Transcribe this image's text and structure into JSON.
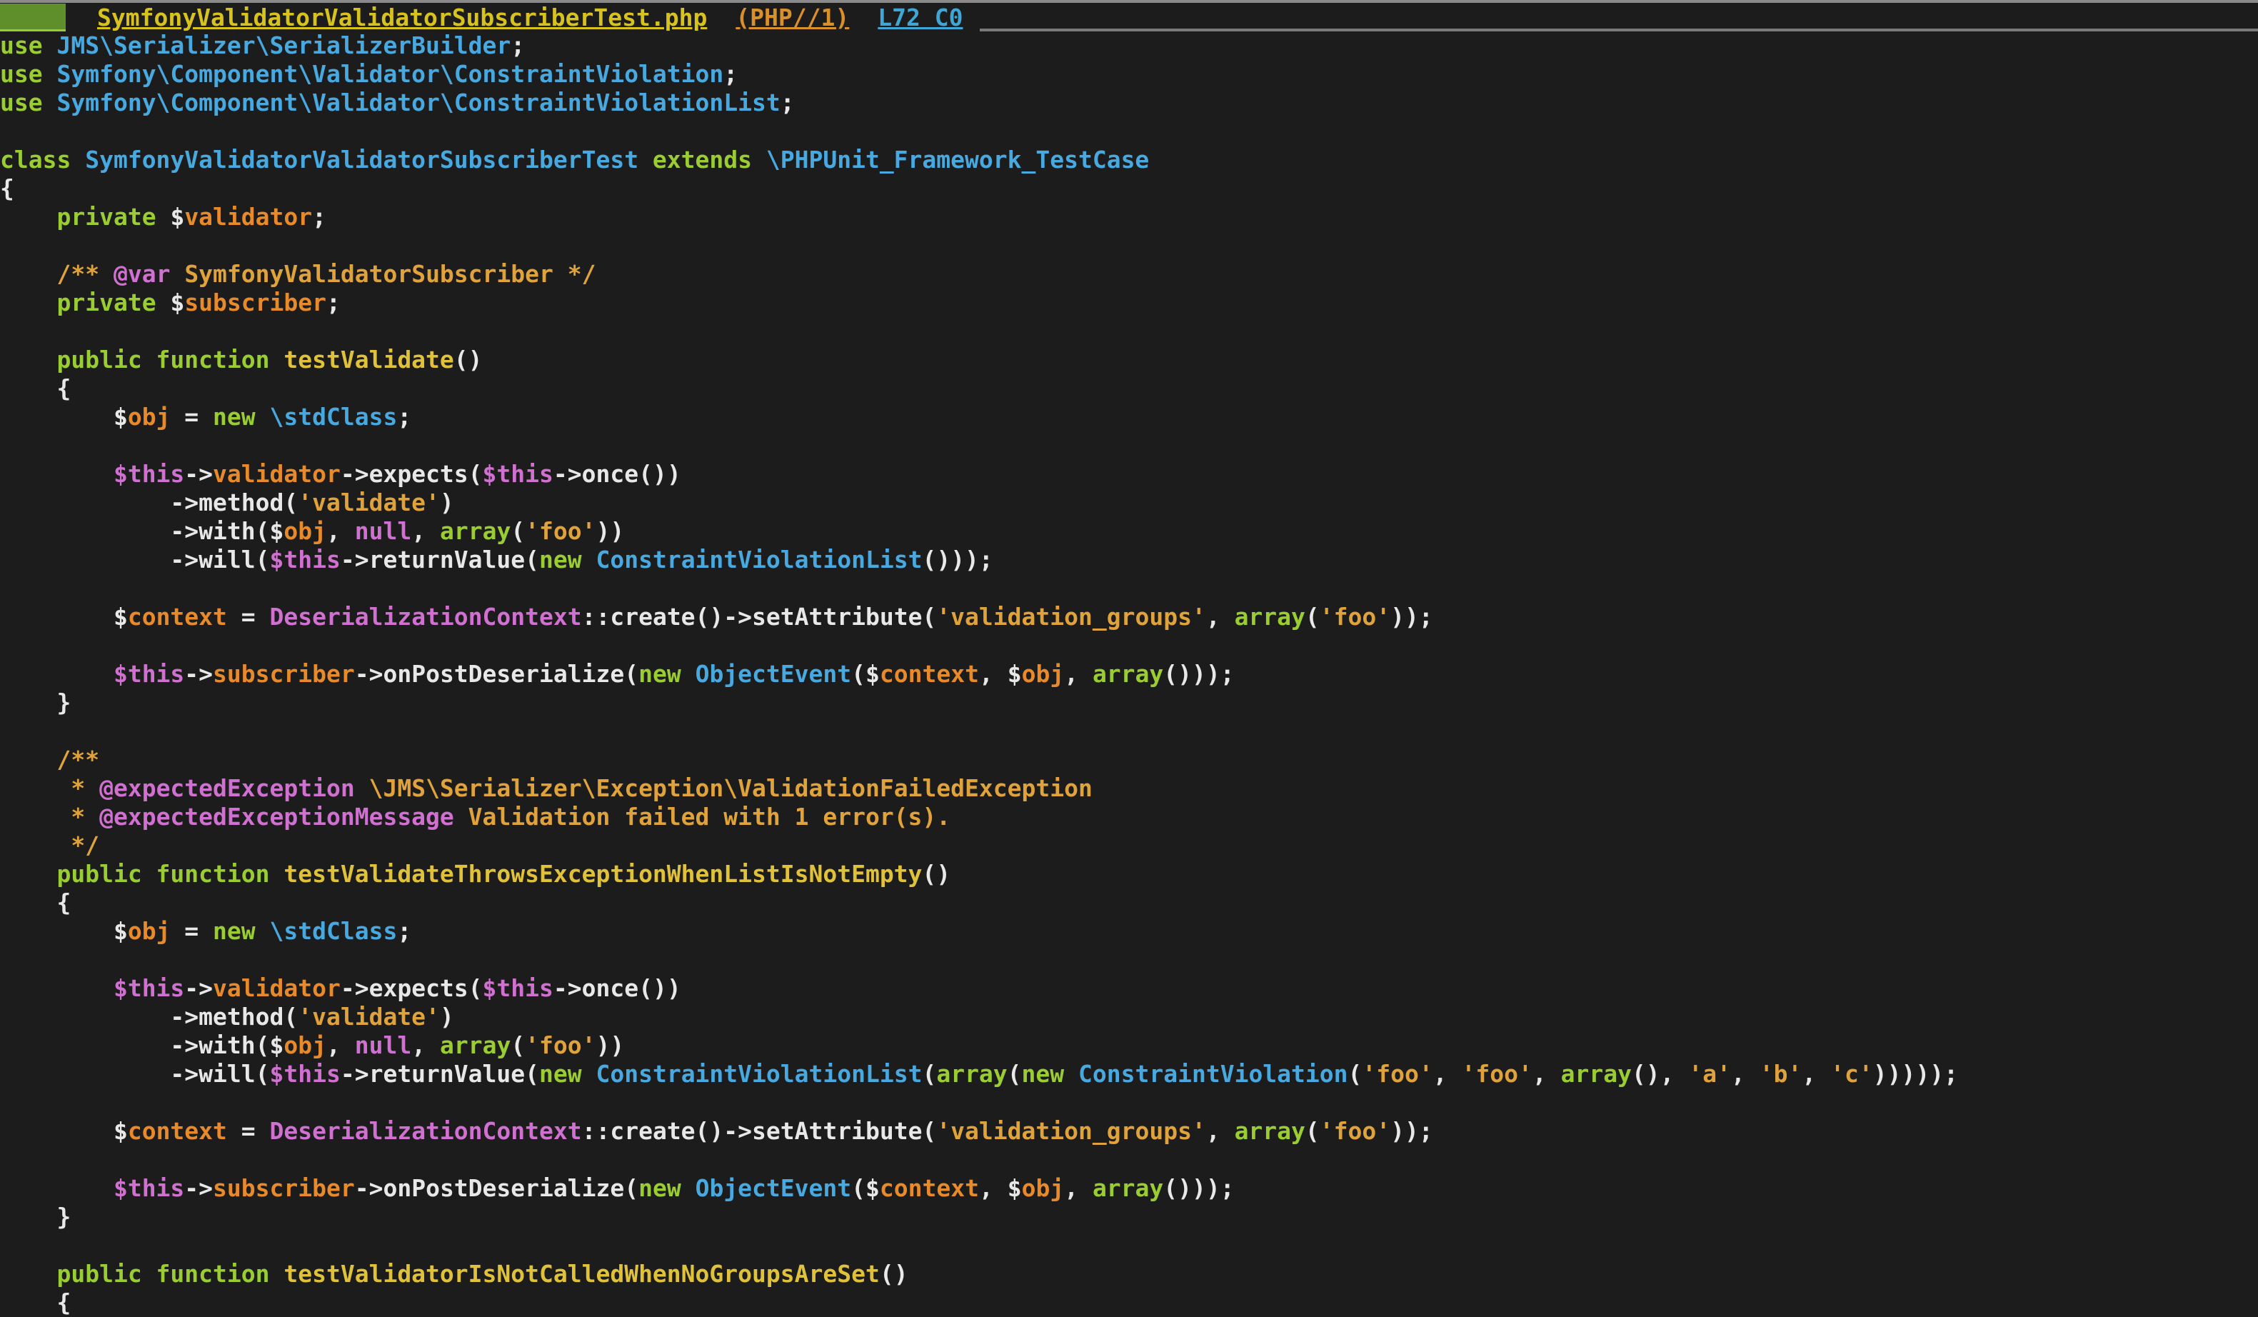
{
  "tabline": {
    "filename": "SymfonyValidatorValidatorSubscriberTest.php",
    "filetype": "(PHP//1)",
    "position": "L72 C0"
  },
  "code_lines": [
    [
      [
        "kw",
        "use "
      ],
      [
        "cls",
        "JMS\\Serializer\\SerializerBuilder"
      ],
      [
        "plain",
        ";"
      ]
    ],
    [
      [
        "kw",
        "use "
      ],
      [
        "cls",
        "Symfony\\Component\\Validator\\ConstraintViolation"
      ],
      [
        "plain",
        ";"
      ]
    ],
    [
      [
        "kw",
        "use "
      ],
      [
        "cls",
        "Symfony\\Component\\Validator\\ConstraintViolationList"
      ],
      [
        "plain",
        ";"
      ]
    ],
    [],
    [
      [
        "kw",
        "class "
      ],
      [
        "cls",
        "SymfonyValidatorValidatorSubscriberTest"
      ],
      [
        "kw",
        " extends "
      ],
      [
        "cls",
        "\\PHPUnit_Framework_TestCase"
      ]
    ],
    [
      [
        "plain",
        "{"
      ]
    ],
    [
      [
        "plain",
        "    "
      ],
      [
        "kw",
        "private "
      ],
      [
        "dlr",
        "$"
      ],
      [
        "var",
        "validator"
      ],
      [
        "plain",
        ";"
      ]
    ],
    [],
    [
      [
        "plain",
        "    "
      ],
      [
        "cmt",
        "/** "
      ],
      [
        "ann",
        "@var "
      ],
      [
        "cmt",
        "SymfonyValidatorSubscriber */"
      ]
    ],
    [
      [
        "plain",
        "    "
      ],
      [
        "kw",
        "private "
      ],
      [
        "dlr",
        "$"
      ],
      [
        "var",
        "subscriber"
      ],
      [
        "plain",
        ";"
      ]
    ],
    [],
    [
      [
        "plain",
        "    "
      ],
      [
        "kw",
        "public function "
      ],
      [
        "fn",
        "testValidate"
      ],
      [
        "plain",
        "()"
      ]
    ],
    [
      [
        "plain",
        "    {"
      ]
    ],
    [
      [
        "plain",
        "        "
      ],
      [
        "dlr",
        "$"
      ],
      [
        "var",
        "obj"
      ],
      [
        "plain",
        " = "
      ],
      [
        "kw",
        "new "
      ],
      [
        "cls",
        "\\stdClass"
      ],
      [
        "plain",
        ";"
      ]
    ],
    [],
    [
      [
        "plain",
        "        "
      ],
      [
        "this",
        "$this"
      ],
      [
        "plain",
        "->"
      ],
      [
        "var",
        "validator"
      ],
      [
        "plain",
        "->expects("
      ],
      [
        "this",
        "$this"
      ],
      [
        "plain",
        "->once())"
      ]
    ],
    [
      [
        "plain",
        "            ->method("
      ],
      [
        "str",
        "'validate'"
      ],
      [
        "plain",
        ")"
      ]
    ],
    [
      [
        "plain",
        "            ->with("
      ],
      [
        "dlr",
        "$"
      ],
      [
        "var",
        "obj"
      ],
      [
        "plain",
        ", "
      ],
      [
        "this",
        "null"
      ],
      [
        "plain",
        ", "
      ],
      [
        "kw",
        "array"
      ],
      [
        "plain",
        "("
      ],
      [
        "str",
        "'foo'"
      ],
      [
        "plain",
        "))"
      ]
    ],
    [
      [
        "plain",
        "            ->will("
      ],
      [
        "this",
        "$this"
      ],
      [
        "plain",
        "->returnValue("
      ],
      [
        "kw",
        "new "
      ],
      [
        "cls",
        "ConstraintViolationList"
      ],
      [
        "plain",
        "()));"
      ]
    ],
    [],
    [
      [
        "plain",
        "        "
      ],
      [
        "dlr",
        "$"
      ],
      [
        "var",
        "context"
      ],
      [
        "plain",
        " = "
      ],
      [
        "this",
        "DeserializationContext"
      ],
      [
        "plain",
        "::create()->setAttribute("
      ],
      [
        "str",
        "'validation_groups'"
      ],
      [
        "plain",
        ", "
      ],
      [
        "kw",
        "array"
      ],
      [
        "plain",
        "("
      ],
      [
        "str",
        "'foo'"
      ],
      [
        "plain",
        "));"
      ]
    ],
    [],
    [
      [
        "plain",
        "        "
      ],
      [
        "this",
        "$this"
      ],
      [
        "plain",
        "->"
      ],
      [
        "var",
        "subscriber"
      ],
      [
        "plain",
        "->onPostDeserialize("
      ],
      [
        "kw",
        "new "
      ],
      [
        "cls",
        "ObjectEvent"
      ],
      [
        "plain",
        "("
      ],
      [
        "dlr",
        "$"
      ],
      [
        "var",
        "context"
      ],
      [
        "plain",
        ", "
      ],
      [
        "dlr",
        "$"
      ],
      [
        "var",
        "obj"
      ],
      [
        "plain",
        ", "
      ],
      [
        "kw",
        "array"
      ],
      [
        "plain",
        "()));"
      ]
    ],
    [
      [
        "plain",
        "    }"
      ]
    ],
    [],
    [
      [
        "plain",
        "    "
      ],
      [
        "cmt",
        "/**"
      ]
    ],
    [
      [
        "plain",
        "     "
      ],
      [
        "cmt",
        "* "
      ],
      [
        "ann",
        "@expectedException "
      ],
      [
        "cmt",
        "\\JMS\\Serializer\\Exception\\ValidationFailedException"
      ]
    ],
    [
      [
        "plain",
        "     "
      ],
      [
        "cmt",
        "* "
      ],
      [
        "ann",
        "@expectedExceptionMessage "
      ],
      [
        "cmt",
        "Validation failed with 1 error(s)."
      ]
    ],
    [
      [
        "plain",
        "     "
      ],
      [
        "cmt",
        "*/"
      ]
    ],
    [
      [
        "plain",
        "    "
      ],
      [
        "kw",
        "public function "
      ],
      [
        "fn",
        "testValidateThrowsExceptionWhenListIsNotEmpty"
      ],
      [
        "plain",
        "()"
      ]
    ],
    [
      [
        "plain",
        "    {"
      ]
    ],
    [
      [
        "plain",
        "        "
      ],
      [
        "dlr",
        "$"
      ],
      [
        "var",
        "obj"
      ],
      [
        "plain",
        " = "
      ],
      [
        "kw",
        "new "
      ],
      [
        "cls",
        "\\stdClass"
      ],
      [
        "plain",
        ";"
      ]
    ],
    [],
    [
      [
        "plain",
        "        "
      ],
      [
        "this",
        "$this"
      ],
      [
        "plain",
        "->"
      ],
      [
        "var",
        "validator"
      ],
      [
        "plain",
        "->expects("
      ],
      [
        "this",
        "$this"
      ],
      [
        "plain",
        "->once())"
      ]
    ],
    [
      [
        "plain",
        "            ->method("
      ],
      [
        "str",
        "'validate'"
      ],
      [
        "plain",
        ")"
      ]
    ],
    [
      [
        "plain",
        "            ->with("
      ],
      [
        "dlr",
        "$"
      ],
      [
        "var",
        "obj"
      ],
      [
        "plain",
        ", "
      ],
      [
        "this",
        "null"
      ],
      [
        "plain",
        ", "
      ],
      [
        "kw",
        "array"
      ],
      [
        "plain",
        "("
      ],
      [
        "str",
        "'foo'"
      ],
      [
        "plain",
        "))"
      ]
    ],
    [
      [
        "plain",
        "            ->will("
      ],
      [
        "this",
        "$this"
      ],
      [
        "plain",
        "->returnValue("
      ],
      [
        "kw",
        "new "
      ],
      [
        "cls",
        "ConstraintViolationList"
      ],
      [
        "plain",
        "("
      ],
      [
        "kw",
        "array"
      ],
      [
        "plain",
        "("
      ],
      [
        "kw",
        "new "
      ],
      [
        "cls",
        "ConstraintViolation"
      ],
      [
        "plain",
        "("
      ],
      [
        "str",
        "'foo'"
      ],
      [
        "plain",
        ", "
      ],
      [
        "str",
        "'foo'"
      ],
      [
        "plain",
        ", "
      ],
      [
        "kw",
        "array"
      ],
      [
        "plain",
        "(), "
      ],
      [
        "str",
        "'a'"
      ],
      [
        "plain",
        ", "
      ],
      [
        "str",
        "'b'"
      ],
      [
        "plain",
        ", "
      ],
      [
        "str",
        "'c'"
      ],
      [
        "plain",
        ")))));"
      ]
    ],
    [],
    [
      [
        "plain",
        "        "
      ],
      [
        "dlr",
        "$"
      ],
      [
        "var",
        "context"
      ],
      [
        "plain",
        " = "
      ],
      [
        "this",
        "DeserializationContext"
      ],
      [
        "plain",
        "::create()->setAttribute("
      ],
      [
        "str",
        "'validation_groups'"
      ],
      [
        "plain",
        ", "
      ],
      [
        "kw",
        "array"
      ],
      [
        "plain",
        "("
      ],
      [
        "str",
        "'foo'"
      ],
      [
        "plain",
        "));"
      ]
    ],
    [],
    [
      [
        "plain",
        "        "
      ],
      [
        "this",
        "$this"
      ],
      [
        "plain",
        "->"
      ],
      [
        "var",
        "subscriber"
      ],
      [
        "plain",
        "->onPostDeserialize("
      ],
      [
        "kw",
        "new "
      ],
      [
        "cls",
        "ObjectEvent"
      ],
      [
        "plain",
        "("
      ],
      [
        "dlr",
        "$"
      ],
      [
        "var",
        "context"
      ],
      [
        "plain",
        ", "
      ],
      [
        "dlr",
        "$"
      ],
      [
        "var",
        "obj"
      ],
      [
        "plain",
        ", "
      ],
      [
        "kw",
        "array"
      ],
      [
        "plain",
        "()));"
      ]
    ],
    [
      [
        "plain",
        "    }"
      ]
    ],
    [],
    [
      [
        "plain",
        "    "
      ],
      [
        "kw",
        "public function "
      ],
      [
        "fn",
        "testValidatorIsNotCalledWhenNoGroupsAreSet"
      ],
      [
        "plain",
        "()"
      ]
    ],
    [
      [
        "plain",
        "    {"
      ]
    ]
  ]
}
